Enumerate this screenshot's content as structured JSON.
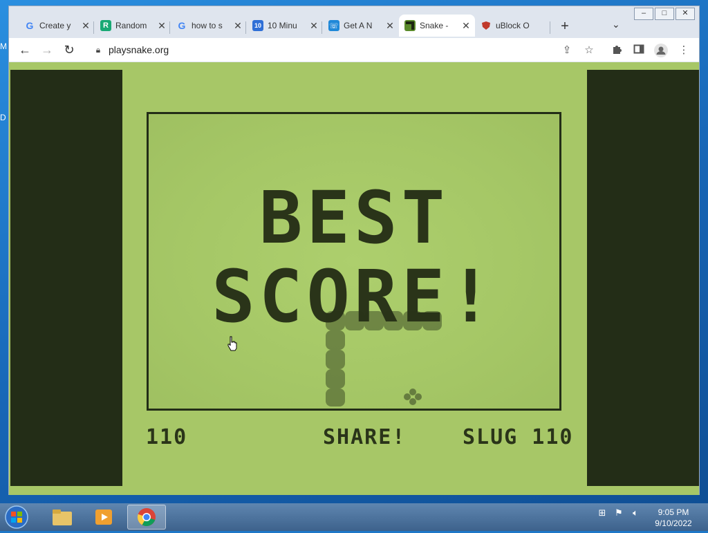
{
  "desktop": {
    "letters": [
      "M",
      "D"
    ]
  },
  "browser": {
    "tabs": [
      {
        "title": "Create y",
        "favicon": "google-g",
        "fav_color": "#4285f4"
      },
      {
        "title": "Random",
        "favicon": "R",
        "fav_color": "#19a974"
      },
      {
        "title": "how to s",
        "favicon": "google-g",
        "fav_color": "#4285f4"
      },
      {
        "title": "10 Minu",
        "favicon": "10",
        "fav_color": "#2f6fd6"
      },
      {
        "title": "Get A N",
        "favicon": "phone-icon",
        "fav_color": "#1f88d8"
      },
      {
        "title": "Snake - ",
        "favicon": "snake-icon",
        "fav_color": "#5a8a2a"
      },
      {
        "title": "uBlock O",
        "favicon": "ublock-icon",
        "fav_color": "#c0392b"
      }
    ],
    "active_tab_index": 5,
    "new_tab": "+",
    "url": "playsnake.org",
    "window_controls": {
      "minimize": "–",
      "maximize": "□",
      "close": "✕"
    }
  },
  "game": {
    "headline_line1": "BEST",
    "headline_line2": "SCORE!",
    "score": "110",
    "share": "SHARE!",
    "rank_label": "SLUG 110",
    "colors": {
      "bg": "#a7c767",
      "dark": "#232d17",
      "text": "#2a3419"
    }
  },
  "taskbar": {
    "time": "9:05 PM",
    "date": "9/10/2022"
  }
}
